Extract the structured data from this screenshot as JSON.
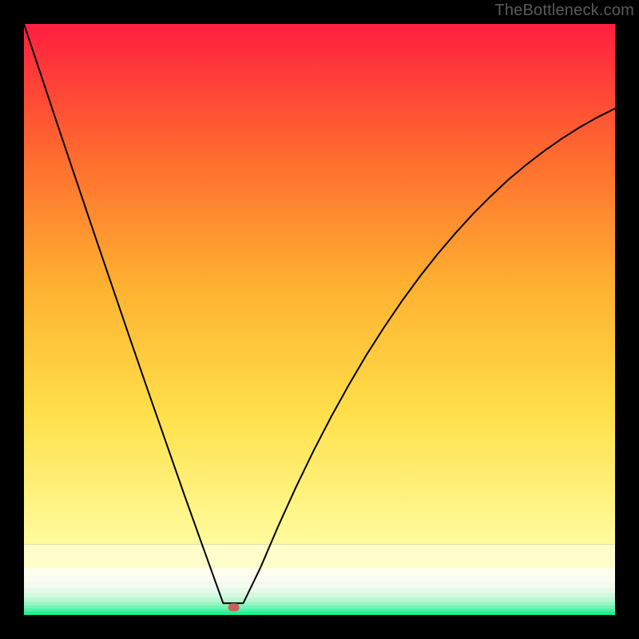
{
  "watermark": "TheBottleneck.com",
  "chart_data": {
    "type": "line",
    "title": "",
    "xlabel": "",
    "ylabel": "",
    "xlim": [
      0,
      100
    ],
    "ylim": [
      0,
      100
    ],
    "grid": false,
    "legend": false,
    "series": [
      {
        "name": "curve",
        "x": [
          0,
          3,
          6,
          9,
          12,
          15,
          18,
          21,
          24,
          27,
          30,
          33.7,
          37.1,
          40,
          43,
          46,
          49,
          52,
          55,
          58,
          61,
          64,
          67,
          70,
          73,
          76,
          79,
          82,
          85,
          88,
          91,
          94,
          97,
          100
        ],
        "values": [
          100,
          91.0,
          82.0,
          73.1,
          64.2,
          55.4,
          46.6,
          37.9,
          29.3,
          20.7,
          12.3,
          2.0,
          2.0,
          8.0,
          15.0,
          21.6,
          27.8,
          33.6,
          39.0,
          44.1,
          48.8,
          53.2,
          57.3,
          61.1,
          64.6,
          67.9,
          70.9,
          73.7,
          76.2,
          78.5,
          80.6,
          82.5,
          84.2,
          85.7
        ]
      }
    ],
    "marker": {
      "x": 35.5,
      "y": 1.3
    },
    "bottom_band": {
      "segments": [
        {
          "y0": 0.0,
          "y1": 0.2,
          "color": "#08f08a"
        },
        {
          "y0": 0.2,
          "y1": 0.5,
          "color": "#1df090"
        },
        {
          "y0": 0.5,
          "y1": 0.8,
          "color": "#36f19a"
        },
        {
          "y0": 0.8,
          "y1": 1.2,
          "color": "#55f3a8"
        },
        {
          "y0": 1.2,
          "y1": 1.7,
          "color": "#76f4b6"
        },
        {
          "y0": 1.7,
          "y1": 2.3,
          "color": "#98f5c4"
        },
        {
          "y0": 2.3,
          "y1": 3.0,
          "color": "#b8f7d2"
        },
        {
          "y0": 3.0,
          "y1": 3.8,
          "color": "#d2f8de"
        },
        {
          "y0": 3.8,
          "y1": 4.7,
          "color": "#e6fae8"
        },
        {
          "y0": 4.7,
          "y1": 5.7,
          "color": "#f3fbee"
        },
        {
          "y0": 5.7,
          "y1": 6.8,
          "color": "#fbfdf1"
        },
        {
          "y0": 6.8,
          "y1": 8.0,
          "color": "#fffff0"
        },
        {
          "y0": 8.0,
          "y1": 12.0,
          "color": "#fffdc9"
        }
      ]
    },
    "gradient_main": {
      "stops": [
        {
          "t": 0.0,
          "color": "#fffc9d"
        },
        {
          "t": 0.25,
          "color": "#ffe04a"
        },
        {
          "t": 0.5,
          "color": "#ffb030"
        },
        {
          "t": 0.75,
          "color": "#ff6a2f"
        },
        {
          "t": 1.0,
          "color": "#ff1f3f"
        }
      ]
    }
  }
}
